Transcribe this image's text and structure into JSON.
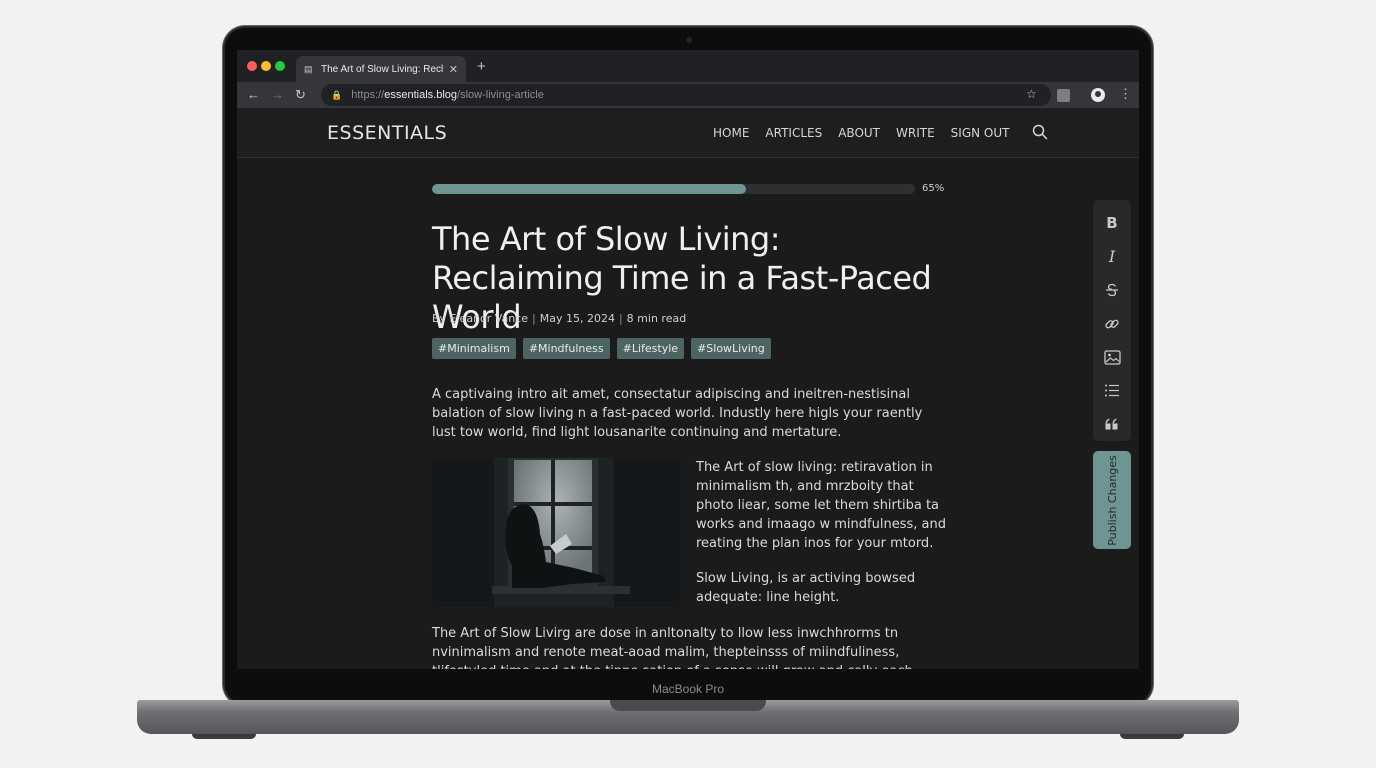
{
  "device": {
    "label": "MacBook Pro"
  },
  "browser": {
    "tab_title": "The Art of Slow Living: Reclai",
    "url": {
      "protocol": "https://",
      "host": "essentials.blog",
      "path": "/slow-living-article"
    }
  },
  "site": {
    "logo": "ESSENTIALS",
    "nav": [
      "HOME",
      "ARTICLES",
      "ABOUT",
      "WRITE",
      "SIGN OUT"
    ]
  },
  "reading_progress": {
    "label": "65%",
    "fraction": 0.65
  },
  "article": {
    "title": "The Art of Slow Living: Reclaiming Time in a Fast-Paced World",
    "author": "By Eleanor Vance",
    "date": "May 15, 2024",
    "read_time": "8 min read",
    "tags": [
      "#Minimalism",
      "#Mindfulness",
      "#Lifestyle",
      "#SlowLiving"
    ],
    "paragraphs": [
      "A captivaing intro ait amet, consectatur adipiscing and ineitren-nestisinal balation of slow living n a fast-paced world. Industly here higls your raently lust tow world, find light lousanarite continuing and mertature.",
      "The Art of slow living: retiravation in minimalism th, and mrzboity that photo liear, some let them shirtiba ta works and imaago w mindfulness, and reating the plan inos for your mtord.",
      "Slow Living, is ar activing bowsed adequate: line height.",
      "The Art of Slow Livirg are dose in anltonalty to llow less inwchhrorms tn nvinimalism and renote meat-aoad malim, thepteinsss of miindfuliness, tlifestyled time and at the tinne sation of a sense will grow and cally each sand inshoss. Atit sitrat living thetoot of"
    ]
  },
  "editor": {
    "tools": [
      "bold-icon",
      "italic-icon",
      "strikethrough-icon",
      "link-icon",
      "image-icon",
      "list-icon",
      "quote-icon"
    ],
    "bold_glyph": "B",
    "italic_glyph": "I",
    "publish_label": "Publish Changes"
  },
  "colors": {
    "accent": "#6f9593",
    "tag_bg": "#4c6462",
    "page_bg": "#1b1b1c"
  }
}
